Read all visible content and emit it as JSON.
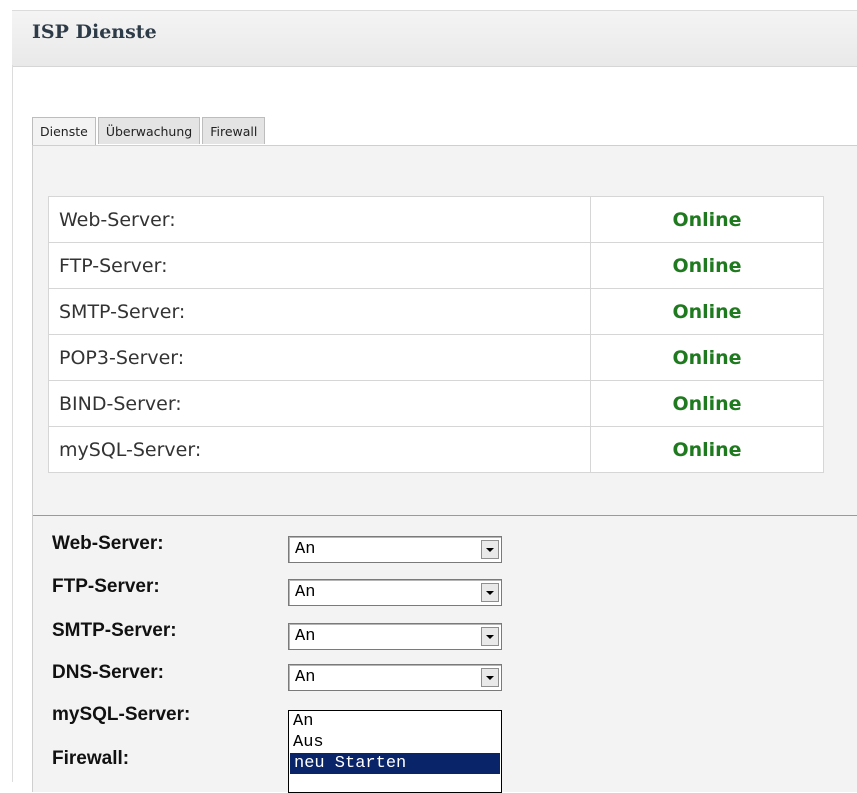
{
  "panel": {
    "title": "ISP Dienste"
  },
  "tabs": [
    {
      "label": "Dienste",
      "active": true
    },
    {
      "label": "Überwachung",
      "active": false
    },
    {
      "label": "Firewall",
      "active": false
    }
  ],
  "status_table": {
    "rows": [
      {
        "name": "Web-Server:",
        "status": "Online"
      },
      {
        "name": "FTP-Server:",
        "status": "Online"
      },
      {
        "name": "SMTP-Server:",
        "status": "Online"
      },
      {
        "name": "POP3-Server:",
        "status": "Online"
      },
      {
        "name": "BIND-Server:",
        "status": "Online"
      },
      {
        "name": "mySQL-Server:",
        "status": "Online"
      }
    ],
    "status_color": "#1f7a1f"
  },
  "controls": {
    "rows": [
      {
        "label": "Web-Server:",
        "value": "An"
      },
      {
        "label": "FTP-Server:",
        "value": "An"
      },
      {
        "label": "SMTP-Server:",
        "value": "An"
      },
      {
        "label": "DNS-Server:",
        "value": "An"
      },
      {
        "label": "mySQL-Server:"
      },
      {
        "label": "Firewall:"
      }
    ],
    "open_dropdown": {
      "options": [
        "An",
        "Aus",
        "neu Starten"
      ],
      "highlighted": "neu Starten"
    }
  },
  "colors": {
    "highlight": "#0a246a",
    "tab_body": "#f3f3f3"
  }
}
